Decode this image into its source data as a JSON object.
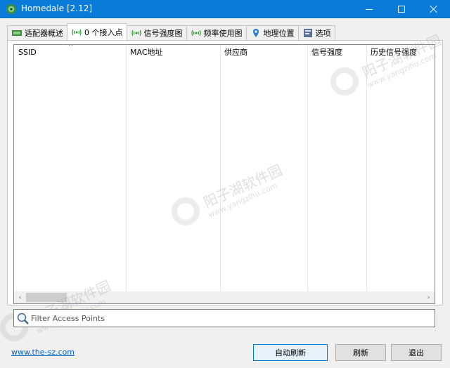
{
  "window": {
    "title": "Homedale [2.12]",
    "icons": {
      "app": "wifi-antenna-icon",
      "minimize": "minimize-icon",
      "maximize": "maximize-icon",
      "close": "close-icon"
    }
  },
  "tabs": [
    {
      "label": "适配器概述",
      "icon": "adapter-card-icon",
      "active": false
    },
    {
      "label": "0 个接入点",
      "icon": "wifi-signal-icon",
      "active": true
    },
    {
      "label": "信号强度图",
      "icon": "wifi-signal-icon",
      "active": false
    },
    {
      "label": "频率使用图",
      "icon": "wifi-signal-icon",
      "active": false
    },
    {
      "label": "地理位置",
      "icon": "location-pin-icon",
      "active": false
    },
    {
      "label": "选项",
      "icon": "options-icon",
      "active": false
    }
  ],
  "list": {
    "sort_indicator": "^",
    "columns": [
      "SSID",
      "MAC地址",
      "供应商",
      "信号强度",
      "历史信号强度"
    ],
    "rows": [],
    "scroll": {
      "left_arrow": "‹",
      "right_arrow": "›"
    }
  },
  "filter": {
    "placeholder": "Filter Access Points",
    "value": "",
    "icon": "magnifier-icon"
  },
  "footer": {
    "link": "www.the-sz.com",
    "buttons": {
      "auto_refresh": "自动刷新",
      "refresh": "刷新",
      "exit": "退出"
    }
  },
  "watermark": {
    "line1": "阳子湖软件园",
    "line2": "www.yangzihu.com"
  },
  "colors": {
    "titlebar": "#0a7bd8",
    "link": "#0066cc",
    "default_button_border": "#0078d7"
  }
}
